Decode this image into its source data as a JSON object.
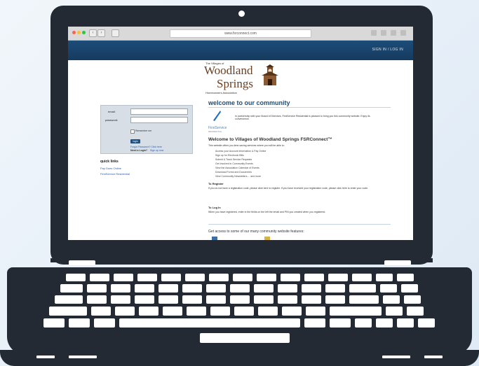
{
  "browser": {
    "url": "www.fsrconnect.com"
  },
  "site": {
    "signin_label": "SIGN IN / LOG IN",
    "logo": {
      "top_line": "The Villages of",
      "line1": "Woodland",
      "line2": "Springs",
      "bottom_line": "Homeowners Association"
    },
    "login": {
      "email_label": "email:",
      "password_label": "password:",
      "remember_label": "Remember me",
      "login_button": "login",
      "forgot_password": "Forgot Password? Click here",
      "need_login": "Need a Login?",
      "sign_up": "Sign up now"
    },
    "quick_links": {
      "title": "quick links",
      "items": [
        "Pay Dues Online",
        "FirstService Residential"
      ]
    },
    "main": {
      "welcome_title": "welcome to our community",
      "intro_text": "In partnership with your Board of Directors, FirstService Residential is pleased to bring you this community website. Enjoy its convenience.",
      "firstservice_name": "FirstService",
      "firstservice_sub": "RESIDENTIAL",
      "heading": "Welcome to Villages of Woodland Springs FSRConnect™",
      "heading_sub": "This website offers you time-saving services where you will be able to:",
      "bullets": [
        "Access your Account Information & Pay Online",
        "Sign up for Electronic Bills",
        "Submit & Track Service Requests",
        "Get Involved in Community Events",
        "View the Association Calendar of Events",
        "Download Forms and Documents",
        "View Community Newsletters ... and more"
      ],
      "register_heading": "To Register",
      "register_text": "If you do not have a registration code, please click here to register. If you have received your registration code, please click here to enter your code.",
      "login_heading": "To Log In",
      "login_text": "When you have registered, enter in the fields on the left the email and PIN you created when you registered.",
      "access_text": "Get access to some of our many community website features:"
    }
  }
}
